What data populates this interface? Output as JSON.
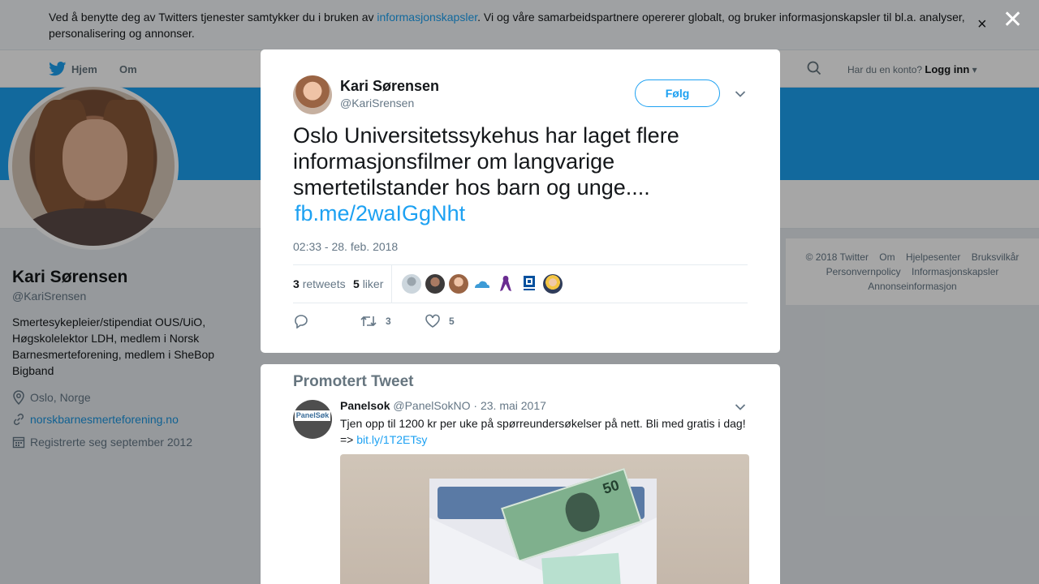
{
  "cookie": {
    "text_before": "Ved å benytte deg av Twitters tjenester samtykker du i bruken av ",
    "link": "informasjonskapsler",
    "text_after": ". Vi og våre samarbeidspartnere opererer globalt, og bruker informasjonskapsler til bl.a. analyser, personalisering og annonser.",
    "close": "×"
  },
  "nav": {
    "home": "Hjem",
    "about": "Om",
    "login_prompt": "Har du en konto?",
    "login": "Logg inn"
  },
  "profile": {
    "name": "Kari Sørensen",
    "handle": "@KariSrensen",
    "bio": "Smertesykepleier/stipendiat OUS/UiO, Høgskolelektor LDH, medlem i Norsk Barnesmerteforening, medlem i SheBop Bigband",
    "location": "Oslo, Norge",
    "website": "norskbarnesmerteforening.no",
    "joined": "Registrerte seg september 2012"
  },
  "footer": {
    "items": [
      "© 2018 Twitter",
      "Om",
      "Hjelpesenter",
      "Bruksvilkår",
      "Personvernpolicy",
      "Informasjonskapsler",
      "Annonseinformasjon"
    ]
  },
  "modal": {
    "close": "✕",
    "name": "Kari Sørensen",
    "handle": "@KariSrensen",
    "follow": "Følg",
    "text": "Oslo Universitetssykehus har laget flere informasjonsfilmer om langvarige smertetilstander hos barn og unge....",
    "link": "fb.me/2waIGgNht",
    "time": "02:33 - 28. feb. 2018",
    "retweets_count": "3",
    "retweets_label": "retweets",
    "likes_count": "5",
    "likes_label": "liker",
    "action_retweets": "3",
    "action_likes": "5"
  },
  "promoted": {
    "title": "Promotert Tweet",
    "avatar_text": "PanelSøk",
    "name": "Panelsok",
    "handle": "@PanelSokNO",
    "date": "· 23. mai 2017",
    "text": "Tjen opp til 1200 kr per uke på spørreundersøkelser på nett. Bli med gratis i dag! =>",
    "link": "bit.ly/1T2ETsy",
    "bill_value": "50"
  },
  "colors": {
    "accent": "#1da1f2",
    "banner": "#1da1f2"
  }
}
